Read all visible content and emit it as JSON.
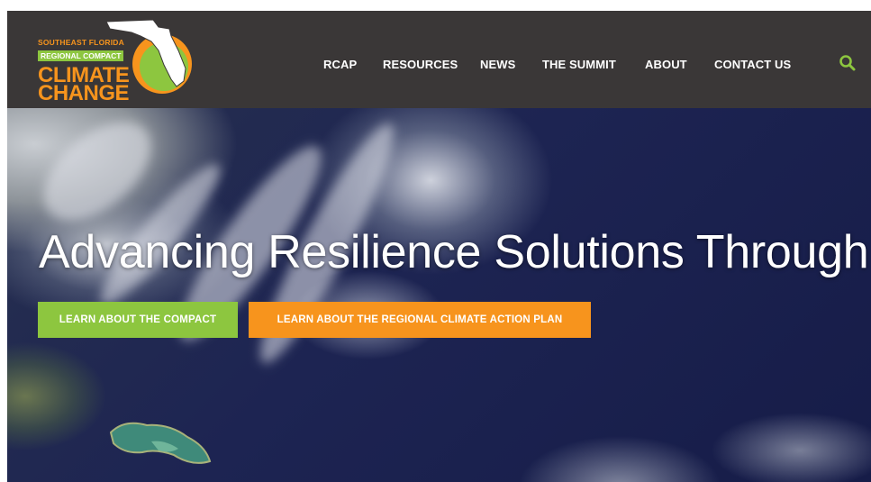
{
  "logo": {
    "line1": "SOUTHEAST FLORIDA",
    "line2": "REGIONAL COMPACT",
    "line3": "CLIMATE",
    "line4": "CHANGE",
    "colors": {
      "orange": "#f7941d",
      "green": "#8dc63f"
    }
  },
  "nav": {
    "items": [
      "RCAP",
      "RESOURCES",
      "NEWS",
      "THE SUMMIT",
      "ABOUT",
      "CONTACT US"
    ],
    "search_icon": "search-icon"
  },
  "hero": {
    "title": "Advancing Resilience Solutions Through",
    "buttons": {
      "compact": "LEARN ABOUT THE COMPACT",
      "plan": "LEARN ABOUT THE REGIONAL CLIMATE ACTION PLAN"
    }
  },
  "colors": {
    "header_bg": "#3a3737",
    "accent_green": "#8dc63f",
    "accent_orange": "#f7941d"
  }
}
